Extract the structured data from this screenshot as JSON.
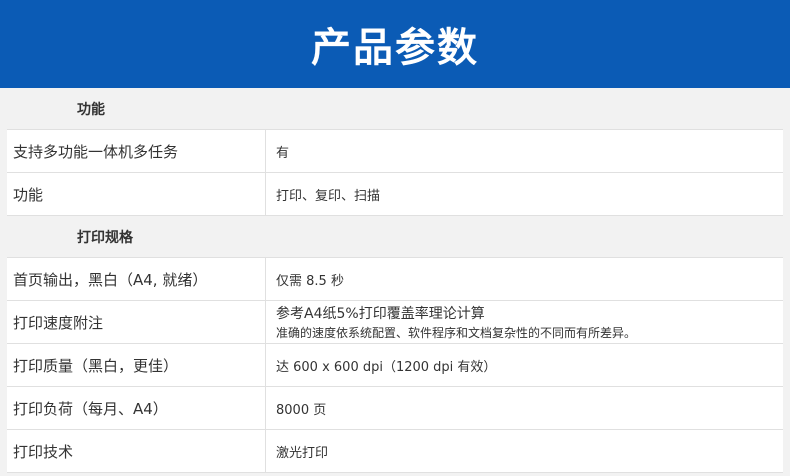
{
  "banner": {
    "title": "产品参数"
  },
  "sections": [
    {
      "title": "功能",
      "rows": [
        {
          "key": "支持多功能一体机多任务",
          "value": "有"
        },
        {
          "key": "功能",
          "value": "打印、复印、扫描"
        }
      ]
    },
    {
      "title": "打印规格",
      "rows": [
        {
          "key": "首页输出，黑白（A4, 就绪）",
          "value": "仅需 8.5 秒"
        },
        {
          "key": "打印速度附注",
          "value": "参考A4纸5%打印覆盖率理论计算",
          "note": "准确的速度依系统配置、软件程序和文档复杂性的不同而有所差异。"
        },
        {
          "key": "打印质量（黑白，更佳）",
          "value": "达 600 x 600 dpi（1200 dpi 有效）"
        },
        {
          "key": "打印负荷（每月、A4）",
          "value": "8000 页"
        },
        {
          "key": "打印技术",
          "value": "激光打印"
        }
      ]
    }
  ]
}
